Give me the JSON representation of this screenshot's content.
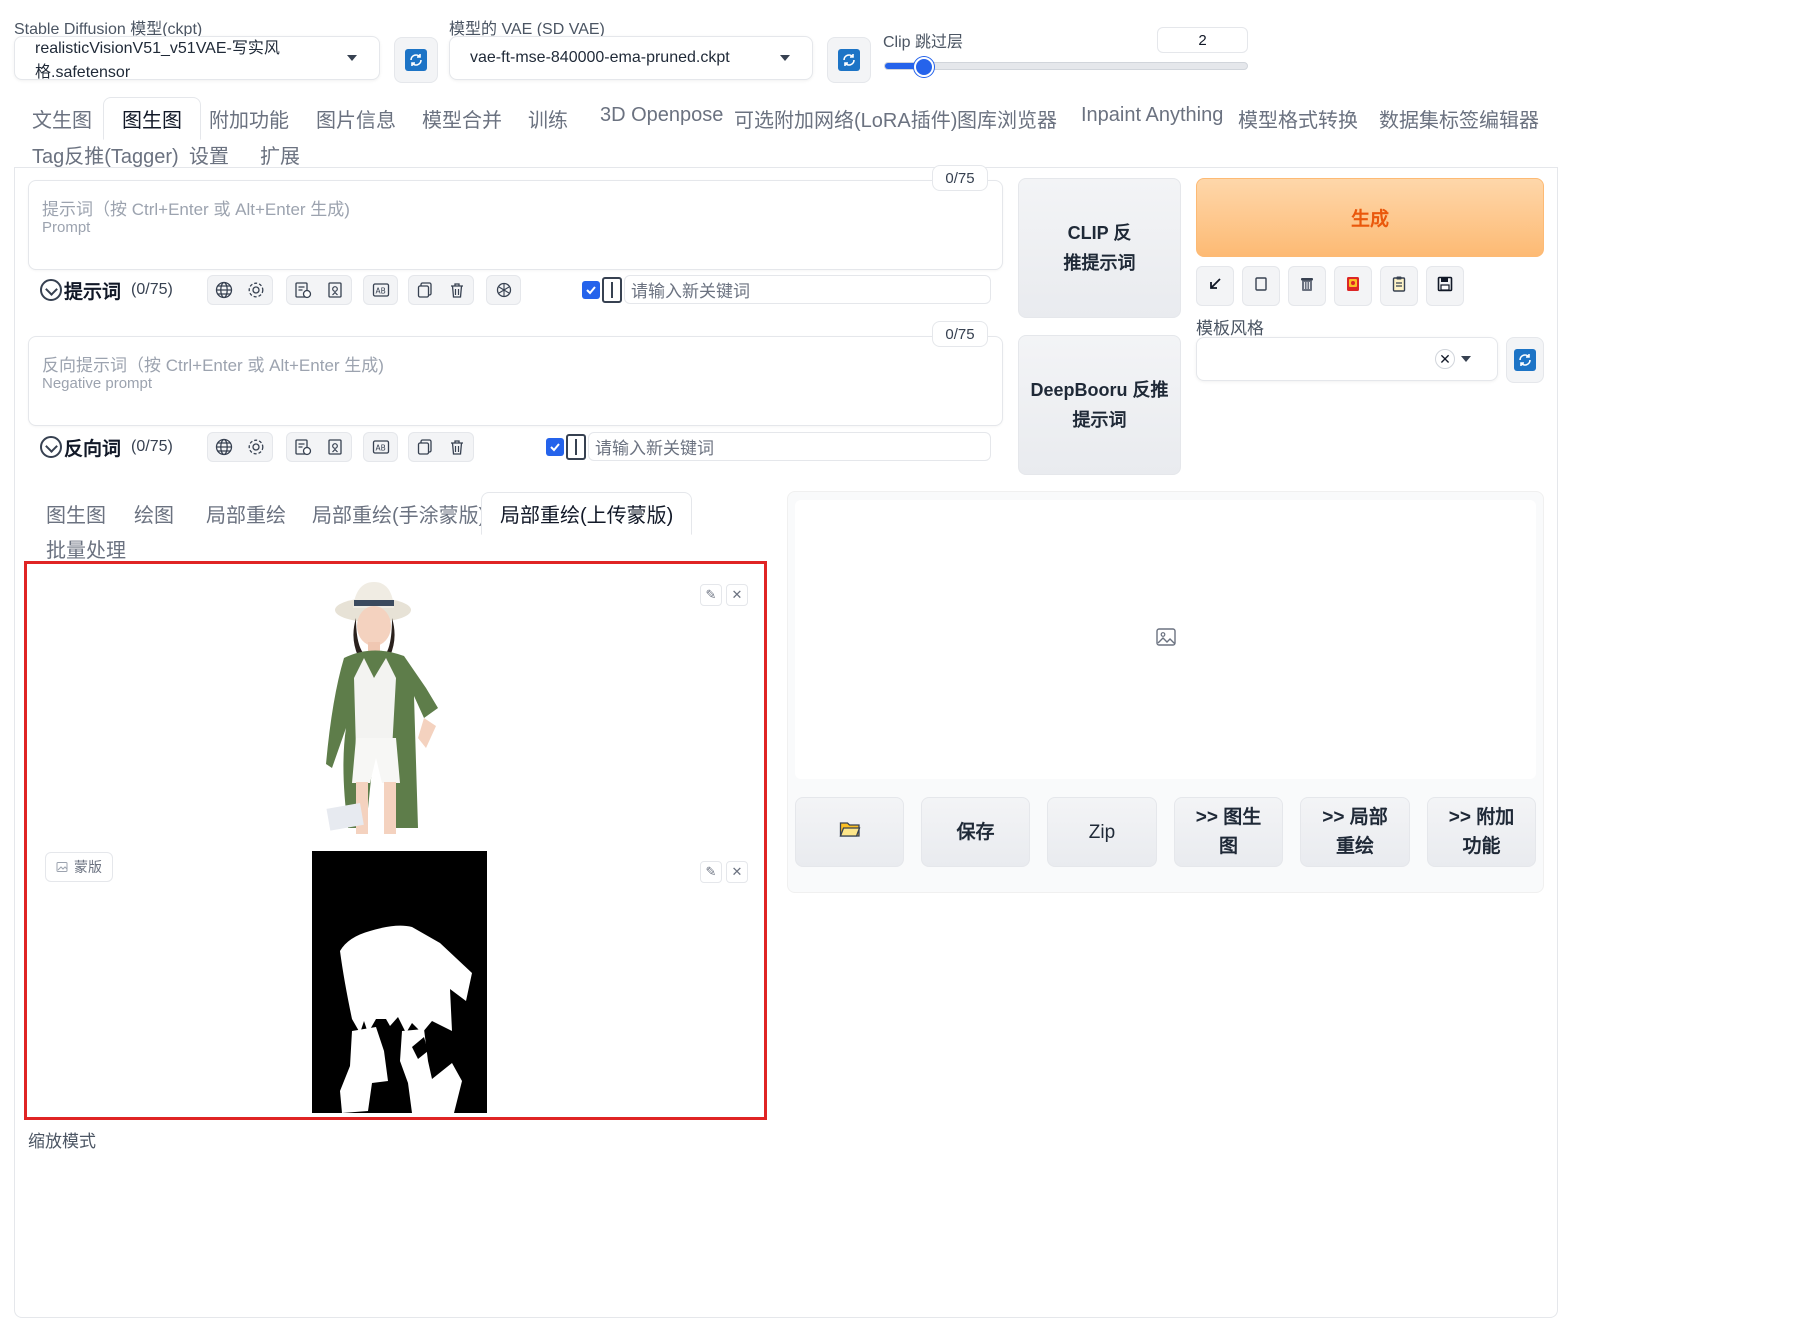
{
  "models": {
    "sd_label": "Stable Diffusion 模型(ckpt)",
    "sd_value": "realisticVisionV51_v51VAE-写实风格.safetensor",
    "vae_label": "模型的 VAE (SD VAE)",
    "vae_value": "vae-ft-mse-840000-ema-pruned.ckpt",
    "clip_label": "Clip 跳过层",
    "clip_value": "2",
    "clip_fraction": 0.11
  },
  "tabs": {
    "row1": [
      "文生图",
      "图生图",
      "附加功能",
      "图片信息",
      "模型合并",
      "训练",
      "3D Openpose",
      "可选附加网络(LoRA插件)",
      "图库浏览器",
      "Inpaint Anything",
      "模型格式转换",
      "数据集标签编辑器"
    ],
    "row2": [
      "Tag反推(Tagger)",
      "设置",
      "扩展"
    ],
    "active": "图生图"
  },
  "prompt": {
    "placeholder_line1": "提示词（按 Ctrl+Enter 或 Alt+Enter 生成)",
    "placeholder_line2": "Prompt",
    "counter": "0/75",
    "toolbar_label": "提示词",
    "toolbar_count": "(0/75)",
    "keyword_placeholder": "请输入新关键词"
  },
  "negative": {
    "placeholder_line1": "反向提示词（按 Ctrl+Enter 或 Alt+Enter 生成)",
    "placeholder_line2": "Negative prompt",
    "counter": "0/75",
    "toolbar_label": "反向词",
    "toolbar_count": "(0/75)",
    "keyword_placeholder": "请输入新关键词"
  },
  "interrogate": {
    "clip_line1": "CLIP 反",
    "clip_line2": "推提示词",
    "deepbooru_line1": "DeepBooru 反推",
    "deepbooru_line2": "提示词"
  },
  "generate": {
    "label": "生成"
  },
  "styles": {
    "label": "模板风格"
  },
  "subtabs": {
    "row1": [
      "图生图",
      "绘图",
      "局部重绘",
      "局部重绘(手涂蒙版)",
      "局部重绘(上传蒙版)"
    ],
    "row2": [
      "批量处理"
    ],
    "active": "局部重绘(上传蒙版)"
  },
  "mask_tag": "蒙版",
  "resize_mode_label": "缩放模式",
  "output_buttons": {
    "save": "保存",
    "zip": "Zip",
    "to_img2img_1": ">> 图生",
    "to_img2img_2": "图",
    "to_inpaint_1": ">> 局部",
    "to_inpaint_2": "重绘",
    "to_extras_1": ">> 附加",
    "to_extras_2": "功能"
  },
  "colors": {
    "accent": "#2563eb",
    "generate_text": "#ea580c",
    "generate_bg": "#fdba74",
    "highlight_border": "#e02424"
  }
}
